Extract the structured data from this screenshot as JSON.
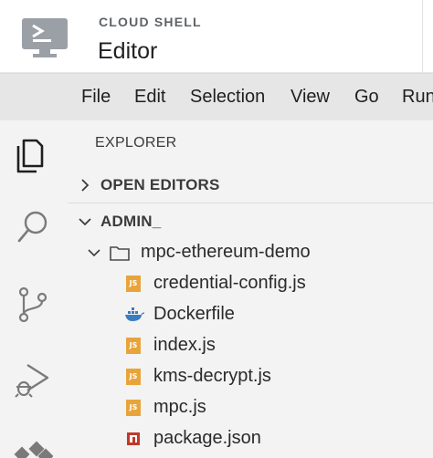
{
  "header": {
    "brand_small": "CLOUD SHELL",
    "brand_large": "Editor",
    "logo_icon": "terminal-monitor-icon"
  },
  "menu": {
    "items": [
      "File",
      "Edit",
      "Selection",
      "View",
      "Go",
      "Run"
    ]
  },
  "activity_bar": {
    "icons": [
      "explorer-icon",
      "search-icon",
      "source-control-icon",
      "run-debug-icon",
      "extensions-icon"
    ]
  },
  "explorer": {
    "title": "EXPLORER",
    "open_editors_label": "OPEN EDITORS",
    "workspace_label": "ADMIN_",
    "folder": {
      "name": "mpc-ethereum-demo",
      "files": [
        {
          "name": "credential-config.js",
          "type": "js"
        },
        {
          "name": "Dockerfile",
          "type": "docker"
        },
        {
          "name": "index.js",
          "type": "js"
        },
        {
          "name": "kms-decrypt.js",
          "type": "js"
        },
        {
          "name": "mpc.js",
          "type": "js"
        },
        {
          "name": "package.json",
          "type": "npm"
        }
      ]
    },
    "js_badge_text": "JS"
  },
  "colors": {
    "js_badge": "#e8a43a",
    "docker": "#3a7dbf",
    "npm": "#c0392b",
    "activity_icon": "#5f6368",
    "active_icon": "#1f1f1f"
  }
}
